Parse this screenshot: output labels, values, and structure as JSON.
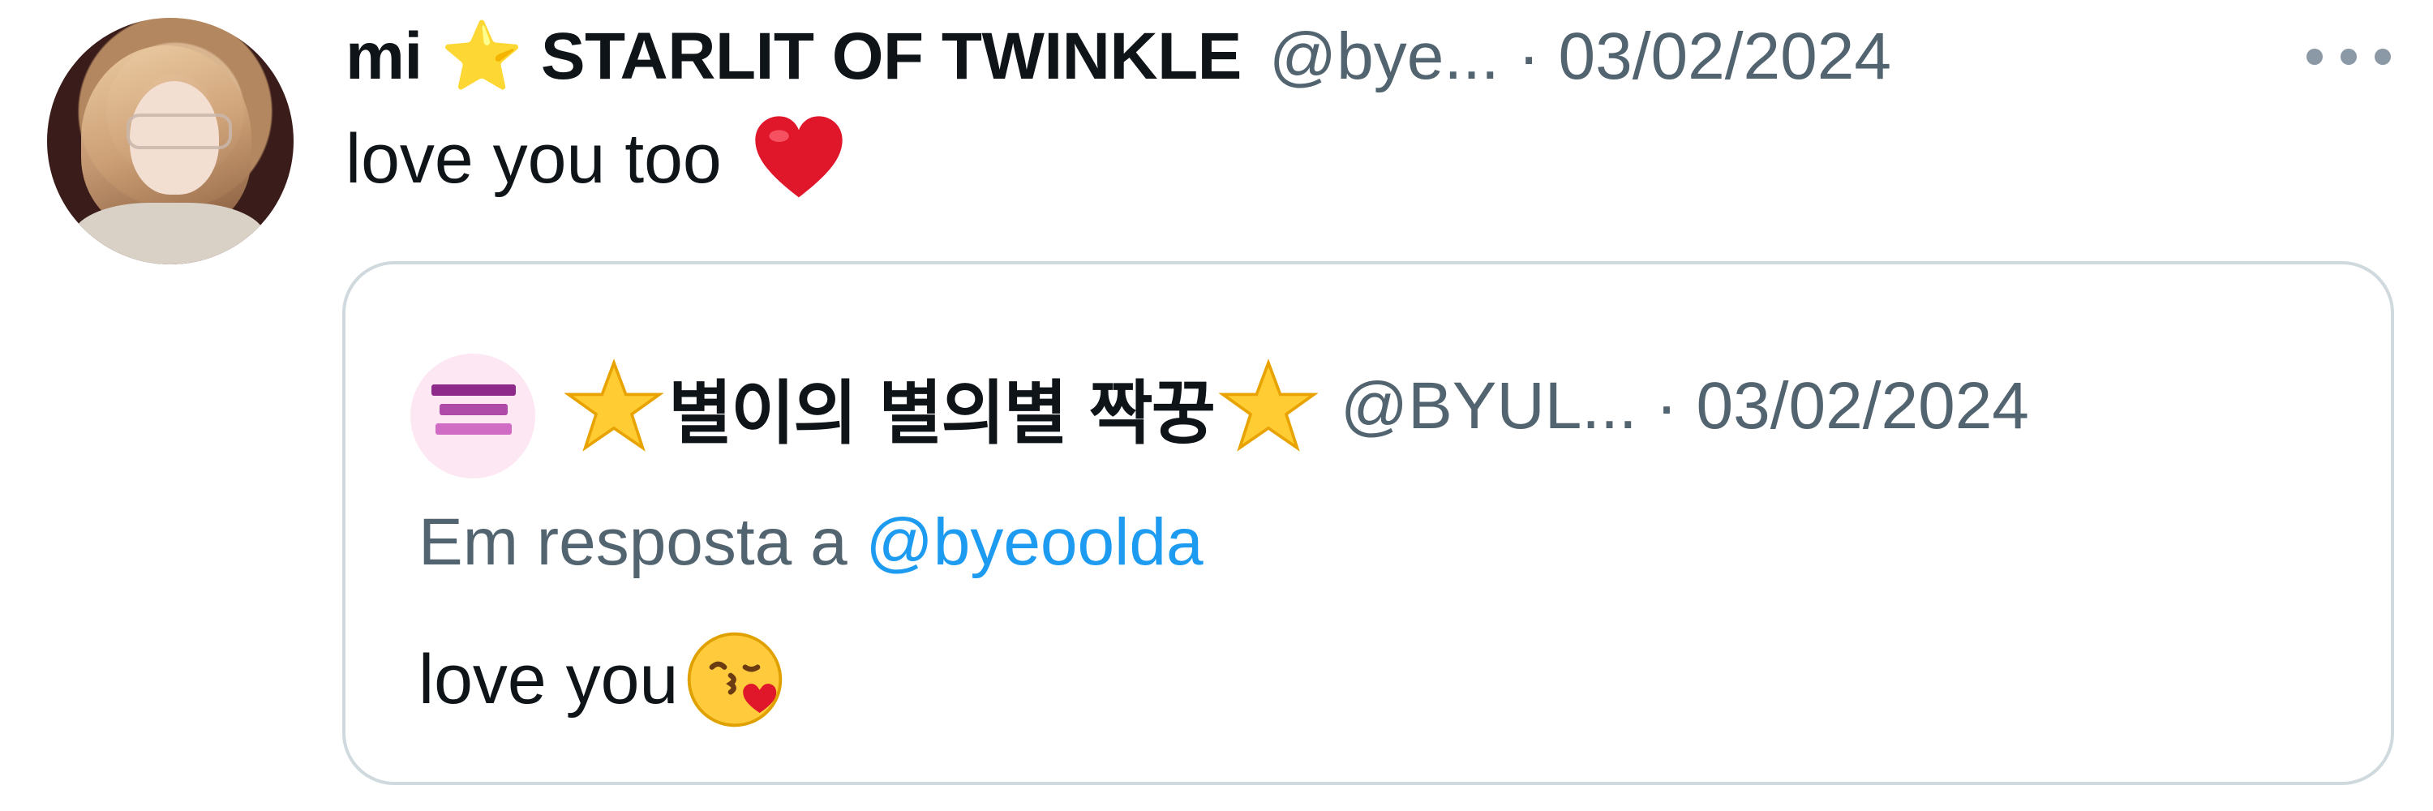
{
  "tweet": {
    "author_name": "mi ⭐ STARLIT OF TWINKLE",
    "author_handle_date": "@bye... · 03/02/2024",
    "text": "love you too",
    "emoji_icon": "red-heart-icon",
    "more_icon": "more-options-icon"
  },
  "quote": {
    "author_name": "별이의 별의별 짝꿍",
    "author_handle_date": "@BYUL... · 03/02/2024",
    "reply_prefix": "Em resposta a",
    "reply_to": "@byeoolda",
    "text": "love you",
    "emoji_icon": "kissing-face-with-heart-icon",
    "star_icon": "star-icon"
  },
  "colors": {
    "primary_text": "#0f1419",
    "secondary_text": "#536471",
    "link": "#1d9bf0",
    "border": "#cfd9de"
  }
}
